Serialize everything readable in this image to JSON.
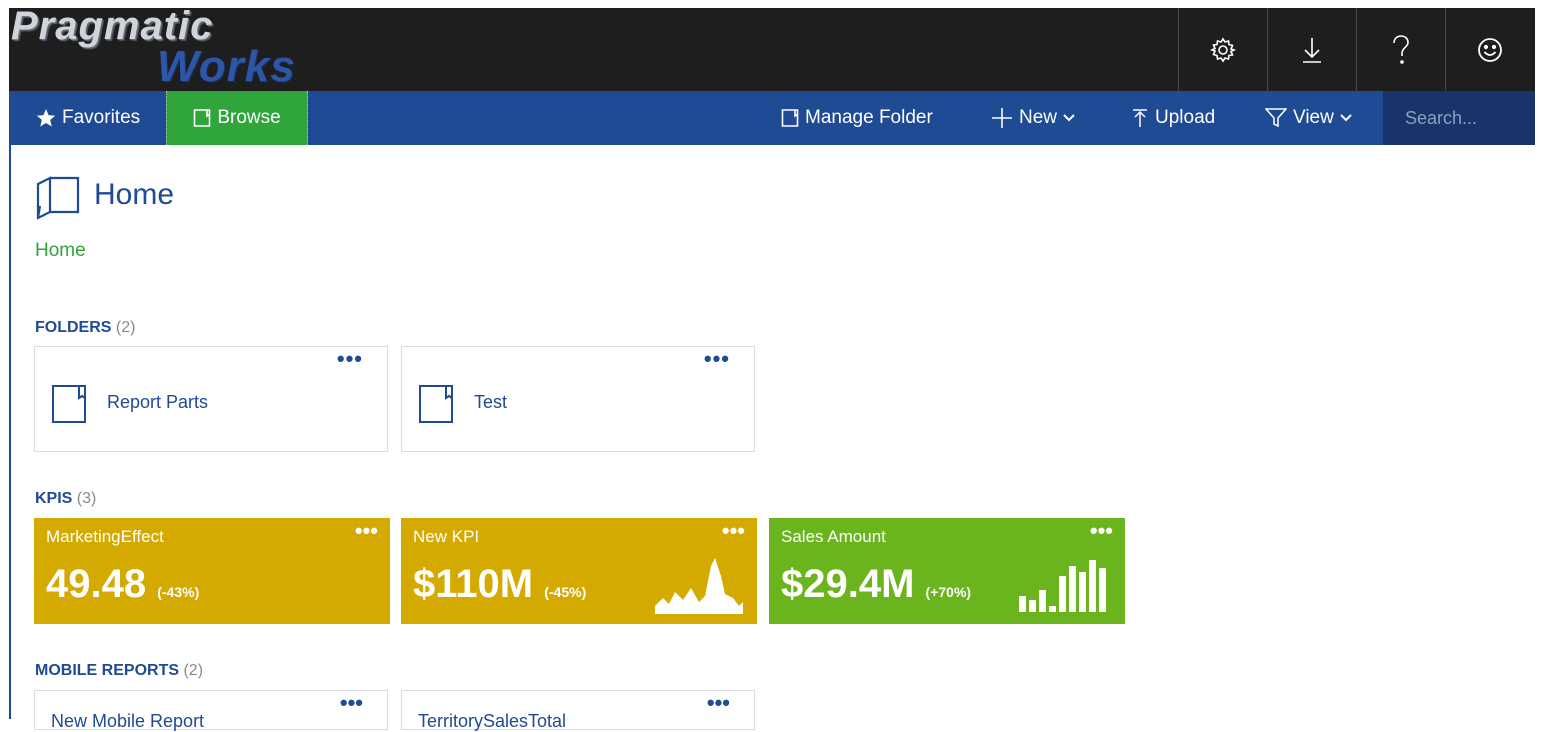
{
  "brand": {
    "line1": "Pragmatic",
    "line2": "Works"
  },
  "header_icons": [
    "gear-icon",
    "download-icon",
    "help-icon",
    "smiley-icon"
  ],
  "nav": {
    "favorites": "Favorites",
    "browse": "Browse",
    "manage_folder": "Manage Folder",
    "new": "New",
    "upload": "Upload",
    "view": "View",
    "search_placeholder": "Search..."
  },
  "page": {
    "title": "Home",
    "breadcrumb": "Home"
  },
  "sections": {
    "folders": {
      "label": "FOLDERS",
      "count": "(2)"
    },
    "kpis": {
      "label": "KPIS",
      "count": "(3)"
    },
    "mobile": {
      "label": "MOBILE REPORTS",
      "count": "(2)"
    }
  },
  "folders": [
    {
      "name": "Report Parts",
      "menu": "•••"
    },
    {
      "name": "Test",
      "menu": "•••"
    }
  ],
  "kpis": [
    {
      "name": "MarketingEffect",
      "value": "49.48",
      "change": "(-43%)",
      "color": "#d4aa00",
      "menu": "•••"
    },
    {
      "name": "New KPI",
      "value": "$110M",
      "change": "(-45%)",
      "color": "#d4aa00",
      "menu": "•••"
    },
    {
      "name": "Sales Amount",
      "value": "$29.4M",
      "change": "(+70%)",
      "color": "#6ab41e",
      "menu": "•••"
    }
  ],
  "mobile_reports": [
    {
      "name": "New Mobile Report",
      "menu": "•••"
    },
    {
      "name": "TerritorySalesTotal",
      "menu": "•••"
    }
  ],
  "colors": {
    "nav_blue": "#1f4a94",
    "browse_green": "#2fa53c",
    "header_black": "#1e1e1e"
  }
}
